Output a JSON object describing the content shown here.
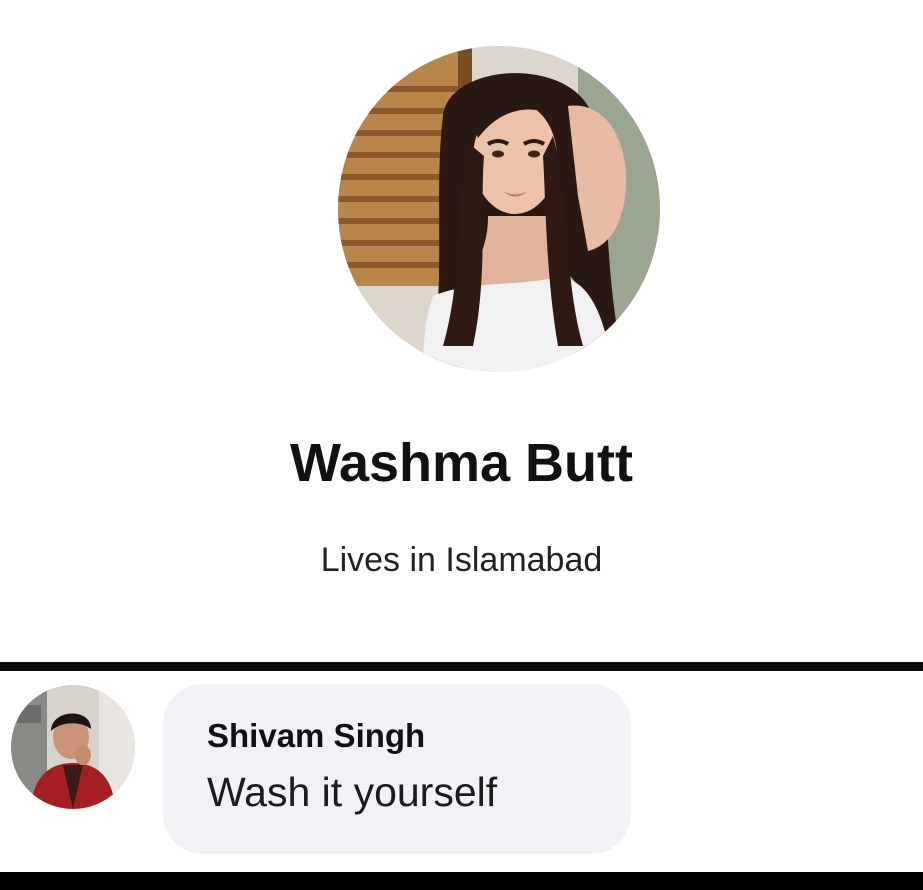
{
  "profile": {
    "name": "Washma Butt",
    "location": "Lives in Islamabad"
  },
  "comment": {
    "author": "Shivam Singh",
    "text": "Wash it yourself"
  },
  "icons": {
    "profile_picture": "profile-photo",
    "commenter_picture": "commenter-photo"
  },
  "colors": {
    "background": "#ffffff",
    "divider": "#0b0b0b",
    "comment_bubble": "#f0f2f5",
    "text_primary": "#111111"
  }
}
